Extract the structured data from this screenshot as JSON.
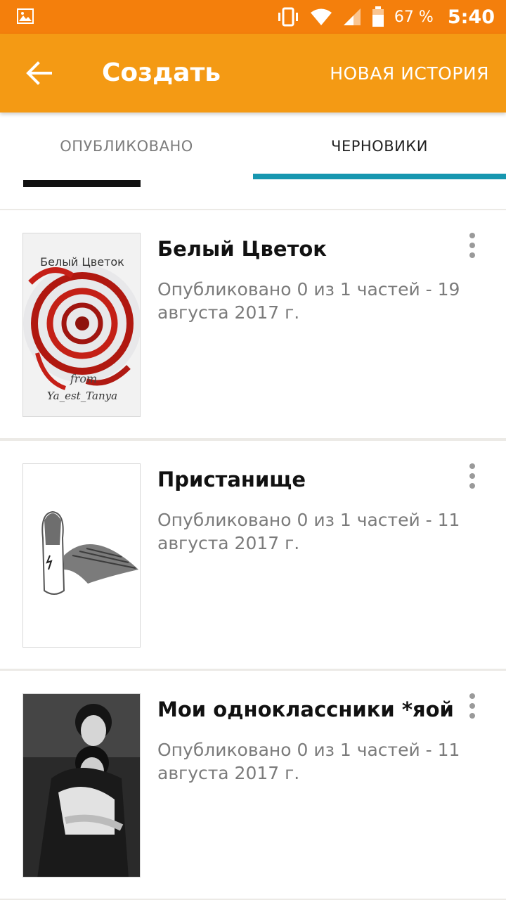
{
  "status_bar": {
    "battery": "67 %",
    "time": "5:40"
  },
  "app_bar": {
    "title": "Создать",
    "action": "НОВАЯ ИСТОРИЯ"
  },
  "tabs": [
    {
      "label": "ОПУБЛИКОВАНО",
      "selected": false
    },
    {
      "label": "ЧЕРНОВИКИ",
      "selected": true
    }
  ],
  "stories": [
    {
      "title": "Белый Цветок",
      "meta": "Опубликовано 0 из 1 частей - 19 августа 2017 г.",
      "cover_text_top": "Белый Цветок",
      "cover_text_mid": "from",
      "cover_text_bottom": "Ya_est_Tanya"
    },
    {
      "title": "Пристанище",
      "meta": "Опубликовано 0 из 1 частей - 11 августа 2017 г."
    },
    {
      "title": "Мои одноклассники *яой",
      "meta": "Опубликовано 0 из 1 частей - 11 августа 2017 г."
    }
  ],
  "colors": {
    "status_bar": "#f47f0c",
    "app_bar": "#f49a14",
    "tab_indicator": "#1797b0"
  }
}
